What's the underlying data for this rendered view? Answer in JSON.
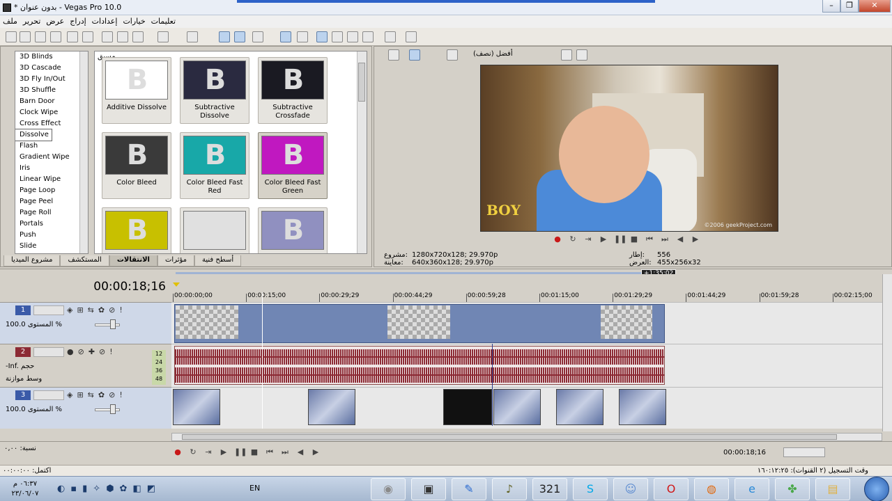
{
  "window": {
    "title": "* بدون عنوان - Vegas Pro 10.0",
    "min": "–",
    "max": "❐",
    "close": "✕"
  },
  "menu": [
    "ملف",
    "تحرير",
    "عرض",
    "إدراج",
    "إعدادات",
    "خيارات",
    "تعليمات"
  ],
  "transitions": {
    "list": [
      "3D Blinds",
      "3D Cascade",
      "3D Fly In/Out",
      "3D Shuffle",
      "Barn Door",
      "Clock Wipe",
      "Cross Effect",
      "Dissolve",
      "Flash",
      "Gradient Wipe",
      "Iris",
      "Linear Wipe",
      "Page Loop",
      "Page Peel",
      "Page Roll",
      "Portals",
      "Push",
      "Slide"
    ],
    "selected_index": 7,
    "header": "مسبق",
    "presets": [
      {
        "label": "Additive Dissolve",
        "color": "#ffffff",
        "glyph": "B"
      },
      {
        "label": "Subtractive Dissolve",
        "color": "#2a2a40",
        "glyph": "B"
      },
      {
        "label": "Subtractive Crossfade",
        "color": "#1a1a22",
        "glyph": "B"
      },
      {
        "label": "Color Bleed",
        "color": "#3a3a3a",
        "glyph": "B"
      },
      {
        "label": "Color Bleed Fast Red",
        "color": "#18a8a8",
        "glyph": "B"
      },
      {
        "label": "Color Bleed Fast Green",
        "color": "#c018c0",
        "glyph": "B"
      },
      {
        "label": "",
        "color": "#c8c000",
        "glyph": "B"
      },
      {
        "label": "",
        "color": "#e0e0e0",
        "glyph": ""
      },
      {
        "label": "",
        "color": "#9090c0",
        "glyph": "B"
      }
    ],
    "selected_preset": 5,
    "tabs": [
      "مشروع الميديا",
      "المستكشف",
      "الانتقالات",
      "مؤثرات",
      "أسطح فنية"
    ],
    "active_tab": 2
  },
  "preview": {
    "quality": "أفضل (نصف)",
    "overlay_text": "BOY",
    "credit": "©2006 geekProject.com",
    "project_label": "مشروع:",
    "project_value": "1280x720x128; 29.970p",
    "preview_label": "معاينة:",
    "preview_value": "640x360x128; 29.970p",
    "frame_label": "إطار:",
    "frame_value": "556",
    "display_label": "العرض:",
    "display_value": "455x256x32"
  },
  "timeline": {
    "current_time": "00:00:18;16",
    "length_badge": "+1:35:02",
    "ruler": [
      "00:00:00;00",
      "00:00:15;00",
      "00:00:29;29",
      "00:00:44;29",
      "00:00:59;28",
      "00:01:15;00",
      "00:01:29;29",
      "00:01:44;29",
      "00:01:59;28",
      "00:02:15;00"
    ],
    "tracks": [
      {
        "num": "1",
        "kind": "video",
        "color": "#3a5aa8",
        "level": "المستوى 100.0 %"
      },
      {
        "num": "2",
        "kind": "audio",
        "color": "#8c2a34",
        "vol": "-Inf. حجم",
        "pan": "وسط موازنة",
        "meter": [
          "12",
          "24",
          "36",
          "48"
        ]
      },
      {
        "num": "3",
        "kind": "video",
        "color": "#3a5aa8",
        "level": "المستوى 100.0 %"
      }
    ],
    "rate": "نسبة: ٠,٠٠",
    "footer_time": "00:00:18;16"
  },
  "status": {
    "left": "اكتمل: ٠٠:٠٠:٠٠",
    "right": "وقت التسجيل (٢ القنوات): ١٦٠:١٢:٢٥"
  },
  "taskbar": {
    "clock_time": "٠٦:٣٧ م",
    "clock_date": "٢٣/٠٦/٠٧",
    "lang": "EN",
    "apps": [
      {
        "name": "app-icon",
        "glyph": "◉",
        "color": "#8a8a8a"
      },
      {
        "name": "vegas-icon",
        "glyph": "▣",
        "color": "#333333"
      },
      {
        "name": "pen-icon",
        "glyph": "✎",
        "color": "#2a6ad0"
      },
      {
        "name": "recorder-icon",
        "glyph": "♪",
        "color": "#606020"
      },
      {
        "name": "clapper-icon",
        "glyph": "321",
        "color": "#222222"
      },
      {
        "name": "skype-icon",
        "glyph": "S",
        "color": "#00a8e8"
      },
      {
        "name": "chat-icon",
        "glyph": "☺",
        "color": "#5a8ad0"
      },
      {
        "name": "opera-icon",
        "glyph": "O",
        "color": "#d01818"
      },
      {
        "name": "firefox-icon",
        "glyph": "◍",
        "color": "#e06a10"
      },
      {
        "name": "ie-icon",
        "glyph": "e",
        "color": "#2a8ad8"
      },
      {
        "name": "network-icon",
        "glyph": "✤",
        "color": "#4aa84a"
      },
      {
        "name": "folder-icon",
        "glyph": "▤",
        "color": "#e0b040"
      }
    ]
  }
}
